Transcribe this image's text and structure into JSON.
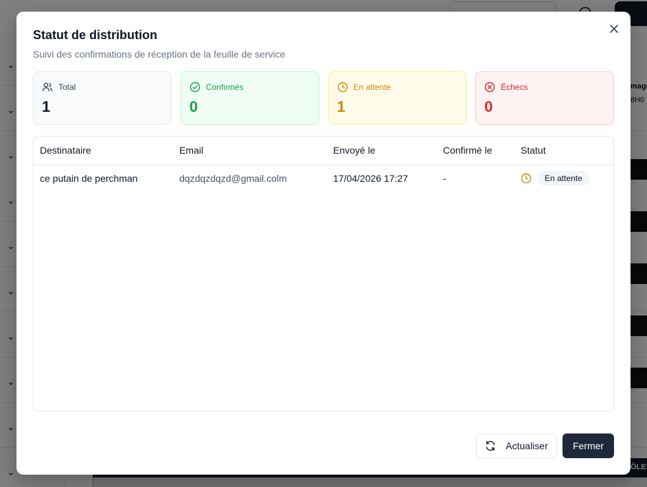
{
  "background": {
    "right_labels": [
      "mage",
      "8H0",
      "ÔLES"
    ]
  },
  "dialog": {
    "title": "Statut de distribution",
    "subtitle": "Suivi des confirmations de réception de la feuille de service",
    "close_icon": "close-icon"
  },
  "stats": [
    {
      "label": "Total",
      "value": "1",
      "icon": "users-icon",
      "color": "#0f172a"
    },
    {
      "label": "Confirmés",
      "value": "0",
      "icon": "check-circle-icon",
      "color": "#16a34a"
    },
    {
      "label": "En attente",
      "value": "1",
      "icon": "clock-icon",
      "color": "#ca8a04"
    },
    {
      "label": "Échecs",
      "value": "0",
      "icon": "x-circle-icon",
      "color": "#dc2626"
    }
  ],
  "table": {
    "headers": [
      "Destinataire",
      "Email",
      "Envoyé le",
      "Confirmé le",
      "Statut"
    ],
    "rows": [
      {
        "destinataire": "ce putain de perchman",
        "email": "dqzdqzdqzd@gmail.colm",
        "envoye": "17/04/2026 17:27",
        "confirme": "-",
        "statut": "En attente"
      }
    ]
  },
  "footer": {
    "refresh_label": "Actualiser",
    "close_label": "Fermer"
  }
}
